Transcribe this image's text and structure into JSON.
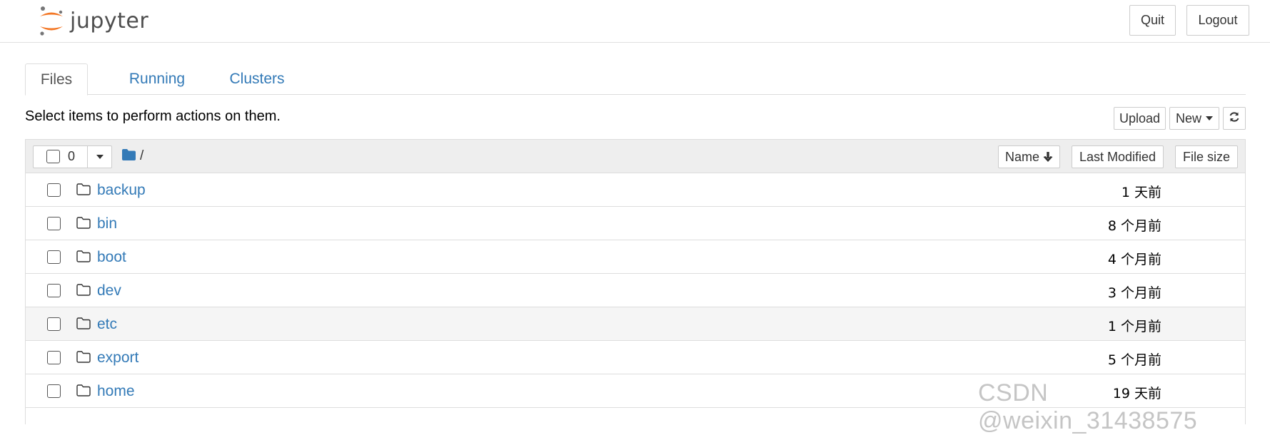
{
  "header": {
    "logo_text": "jupyter",
    "quit_label": "Quit",
    "logout_label": "Logout"
  },
  "tabs": [
    {
      "label": "Files",
      "active": true
    },
    {
      "label": "Running",
      "active": false
    },
    {
      "label": "Clusters",
      "active": false
    }
  ],
  "toolbar": {
    "info_text": "Select items to perform actions on them.",
    "upload_label": "Upload",
    "new_label": "New",
    "refresh_icon": "refresh-icon"
  },
  "list_header": {
    "selected_count": "0",
    "breadcrumb_path": "/",
    "sort_name_label": "Name",
    "sort_modified_label": "Last Modified",
    "sort_size_label": "File size"
  },
  "files": [
    {
      "name": "backup",
      "modified": "1 天前"
    },
    {
      "name": "bin",
      "modified": "8 个月前"
    },
    {
      "name": "boot",
      "modified": "4 个月前"
    },
    {
      "name": "dev",
      "modified": "3 个月前"
    },
    {
      "name": "etc",
      "modified": "1 个月前"
    },
    {
      "name": "export",
      "modified": "5 个月前"
    },
    {
      "name": "home",
      "modified": "19 天前"
    }
  ],
  "watermark": "CSDN @weixin_31438575",
  "colors": {
    "link": "#337ab7",
    "logo_orange": "#f37726",
    "logo_gray": "#767677",
    "header_bg": "#eeeeee"
  }
}
